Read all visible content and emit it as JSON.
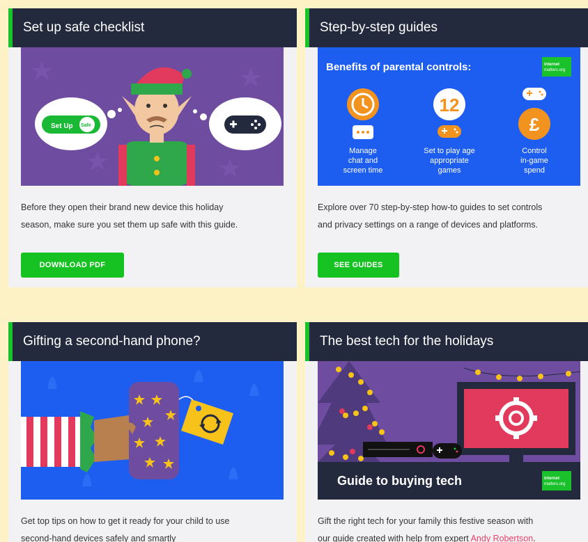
{
  "cards": [
    {
      "title": "Set up safe checklist",
      "desc_line1": "Before they open their brand new device this holiday",
      "desc_line2": "season, make sure you set them up safe with this guide.",
      "button": "DOWNLOAD PDF",
      "image": {
        "badge_text_1": "Set Up",
        "badge_text_2": "Safe"
      }
    },
    {
      "title": "Step-by-step guides",
      "desc_line1": "Explore over 70 step-by-step how-to guides to set controls",
      "desc_line2": "and privacy settings on a range of devices and platforms.",
      "button": "SEE GUIDES",
      "image": {
        "heading": "Benefits of parental controls:",
        "logo_line1": "internet",
        "logo_line2": "matters.org",
        "age": "12",
        "pound": "£",
        "col1": [
          "Manage",
          "chat and",
          "screen time"
        ],
        "col2": [
          "Set to play age",
          "appropriate",
          "games"
        ],
        "col3": [
          "Control",
          "in-game",
          "spend"
        ]
      }
    },
    {
      "title": "Gifting a second-hand phone?",
      "desc_line1": "Get top tips on how to get it ready for your child to use",
      "desc_line2": "second-hand devices safely and smartly"
    },
    {
      "title": "The best tech for the holidays",
      "desc_line1": "Gift the right tech for your family this festive season with",
      "desc_line2_prefix": "our guide created with help from expert ",
      "desc_link": "Andy Robertson",
      "desc_suffix": ".",
      "image": {
        "banner": "Guide to buying tech",
        "logo_line1": "internet",
        "logo_line2": "matters.org"
      }
    }
  ],
  "colors": {
    "page_bg": "#fdf2c6",
    "card_bg": "#f2f2f4",
    "header_bg": "#242a3d",
    "accent_green": "#15c222",
    "link": "#e8436b",
    "purple_bg": "#6e4c9f",
    "blue_bg": "#1d5ef0",
    "orange": "#f29320"
  }
}
